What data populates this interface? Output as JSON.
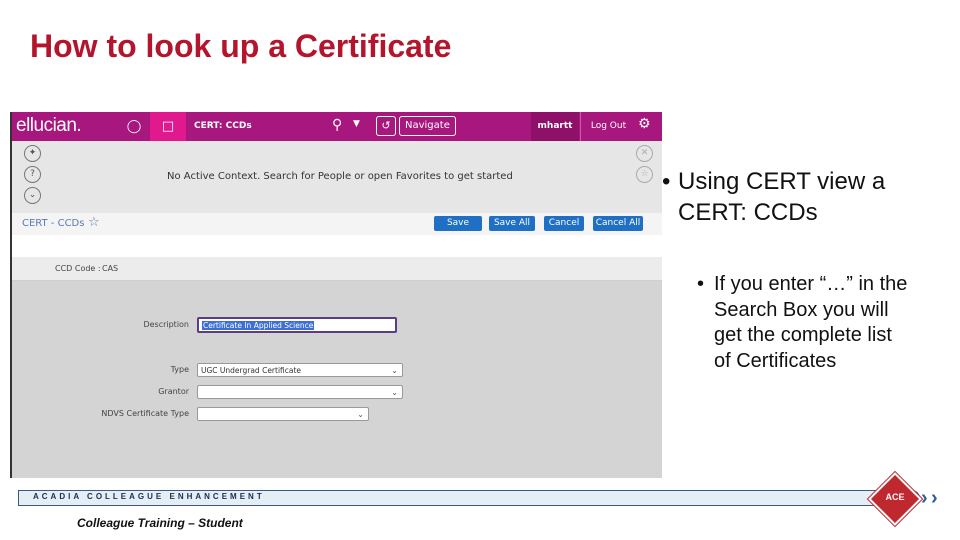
{
  "slide": {
    "title": "How to look up a Certificate",
    "bullet1": "Using CERT view a CERT: CCDs",
    "bullet2": "If you enter “…” in the Search Box you will get the complete list of Certificates",
    "bullet_char": "•",
    "footer_band": "ACADIA COLLEAGUE ENHANCEMENT",
    "footer_logo": "ACE",
    "footer_text": "Colleague Training – Student",
    "colors": {
      "title": "#b3152d",
      "brand": "#a8177e",
      "button": "#1f6fc5"
    }
  },
  "app": {
    "logo": "ellucian.",
    "form_name": "CERT: CCDs",
    "navigate_label": "Navigate",
    "user": "mhartt",
    "logout_label": "Log Out",
    "context_message": "No Active Context. Search for People or open Favorites to get started",
    "form_title": "CERT - CCDs",
    "buttons": {
      "save": "Save",
      "save_all": "Save All",
      "cancel": "Cancel",
      "cancel_all": "Cancel All"
    },
    "ccd_code_label": "CCD Code :",
    "ccd_code_value": "CAS",
    "fields": {
      "description_label": "Description",
      "description_value": "Certificate In Applied Science",
      "type_label": "Type",
      "type_value": "UGC Undergrad Certificate",
      "grantor_label": "Grantor",
      "grantor_value": "",
      "ndvs_label": "NDVS Certificate Type",
      "ndvs_value": ""
    },
    "icons": [
      "user-icon",
      "document-icon",
      "search-icon",
      "chevron-down-icon",
      "history-icon",
      "gear-icon",
      "pin-icon",
      "help-icon",
      "collapse-icon",
      "close-icon",
      "favorite-icon",
      "star-icon"
    ]
  }
}
